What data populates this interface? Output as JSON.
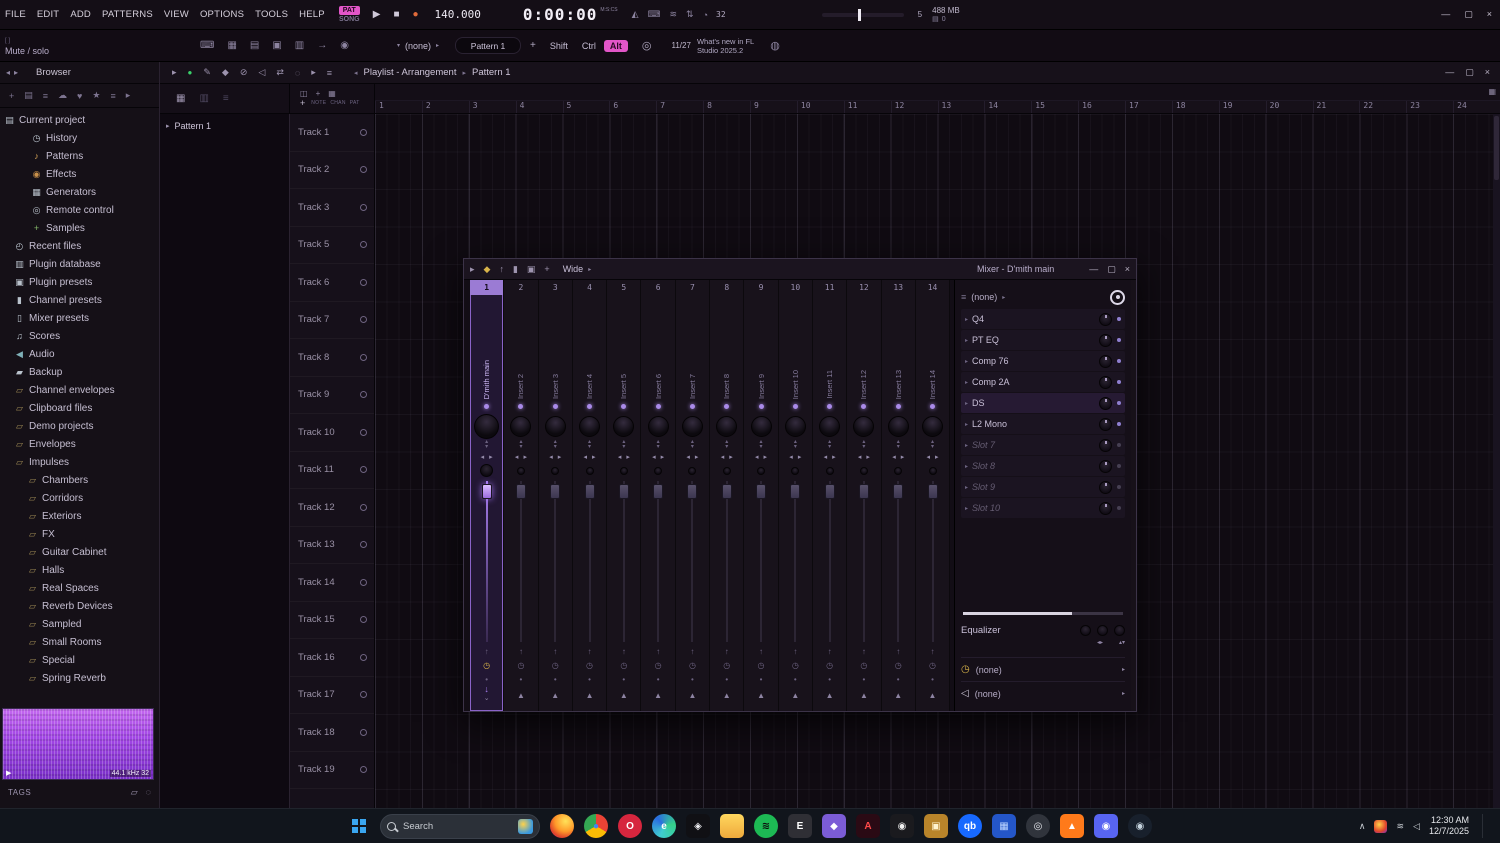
{
  "window": {
    "minimize": "—",
    "maximize": "▢",
    "close": "×"
  },
  "titlebar": {
    "menus": [
      "FILE",
      "EDIT",
      "ADD",
      "PATTERNS",
      "VIEW",
      "OPTIONS",
      "TOOLS",
      "HELP"
    ],
    "pat": "PAT",
    "song": "SONG",
    "play": "▶",
    "stop": "■",
    "record": "●",
    "tempo": "140.000",
    "time": "0:00:00",
    "time_unit": "M:S:CS",
    "count_label": "32",
    "mid_icons": [
      {
        "name": "metronome-icon",
        "glyph": "◭"
      },
      {
        "name": "typing-keyboard-icon",
        "glyph": "⌨"
      },
      {
        "name": "wave-icon",
        "glyph": "≋"
      },
      {
        "name": "multilink-icon",
        "glyph": "⇅"
      },
      {
        "name": "countdown-icon",
        "glyph": "◔"
      }
    ],
    "marker_value": "5",
    "mem": "488 MB",
    "disk_glyph": "▤",
    "disk_value": "0"
  },
  "hintbar": {
    "brackets": "[ ]",
    "hint": "Mute / solo",
    "left_icons": [
      {
        "name": "typing-to-piano-icon",
        "glyph": "⌨"
      },
      {
        "name": "piano-keyboard-icon",
        "glyph": "▦"
      },
      {
        "name": "step-edit-icon",
        "glyph": "▤"
      },
      {
        "name": "note-grid-icon",
        "glyph": "▣"
      },
      {
        "name": "snap-icon",
        "glyph": "▥"
      },
      {
        "name": "arrow-tool-icon",
        "glyph": "→"
      },
      {
        "name": "mic-icon",
        "glyph": "◉"
      }
    ],
    "selector_down": "▾",
    "selector_value": "(none)",
    "selector_right": "▸",
    "pattern_display": "Pattern 1",
    "add_label": "+",
    "shift": "Shift",
    "ctrl": "Ctrl",
    "alt": "Alt",
    "swirl_glyph": "◎",
    "news_date": "11/27",
    "news_line1": "What's new in FL",
    "news_line2": "Studio 2025.2",
    "globe_glyph": "◍"
  },
  "browser": {
    "nav_left": "◂",
    "nav_right": "▸",
    "title": "Browser",
    "tool_icons": [
      {
        "name": "add-icon",
        "glyph": "+"
      },
      {
        "name": "file-icon",
        "glyph": "▤"
      },
      {
        "name": "sort-icon",
        "glyph": "≡"
      },
      {
        "name": "cloud-icon",
        "glyph": "☁"
      },
      {
        "name": "heart-icon",
        "glyph": "♥"
      },
      {
        "name": "star-icon",
        "glyph": "★"
      },
      {
        "name": "list-icon",
        "glyph": "≡"
      },
      {
        "name": "expand-icon",
        "glyph": "▸"
      }
    ],
    "items": [
      {
        "label": "Current project",
        "icon": "project-icon",
        "glyph": "▤",
        "color": "#b9c2cc",
        "cls": "lv0"
      },
      {
        "label": "History",
        "icon": "history-icon",
        "glyph": "◷",
        "color": "#b9c2cc",
        "cls": "lv1"
      },
      {
        "label": "Patterns",
        "icon": "pattern-icon",
        "glyph": "♪",
        "color": "#d9a65a",
        "cls": "lv1"
      },
      {
        "label": "Effects",
        "icon": "effects-icon",
        "glyph": "◉",
        "color": "#c9904a",
        "cls": "lv1"
      },
      {
        "label": "Generators",
        "icon": "generators-icon",
        "glyph": "▦",
        "color": "#b9c2cc",
        "cls": "lv1"
      },
      {
        "label": "Remote control",
        "icon": "remote-control-icon",
        "glyph": "◎",
        "color": "#b9c2cc",
        "cls": "lv1"
      },
      {
        "label": "Samples",
        "icon": "samples-icon",
        "glyph": "+",
        "color": "#85b86a",
        "cls": "lv1"
      },
      {
        "label": "Recent files",
        "icon": "recent-files-icon",
        "glyph": "◴",
        "color": "#b9c2cc",
        "cls": "lv2"
      },
      {
        "label": "Plugin database",
        "icon": "plugin-database-icon",
        "glyph": "▥",
        "color": "#b9c2cc",
        "cls": "lv2"
      },
      {
        "label": "Plugin presets",
        "icon": "plugin-presets-icon",
        "glyph": "▣",
        "color": "#b9c2cc",
        "cls": "lv2"
      },
      {
        "label": "Channel presets",
        "icon": "channel-presets-icon",
        "glyph": "▮",
        "color": "#b9c2cc",
        "cls": "lv2"
      },
      {
        "label": "Mixer presets",
        "icon": "mixer-presets-icon",
        "glyph": "▯",
        "color": "#b9c2cc",
        "cls": "lv2"
      },
      {
        "label": "Scores",
        "icon": "scores-icon",
        "glyph": "♫",
        "color": "#b9c2cc",
        "cls": "lv2"
      },
      {
        "label": "Audio",
        "icon": "audio-icon",
        "glyph": "◀",
        "color": "#7fb0b8",
        "cls": "lv2"
      },
      {
        "label": "Backup",
        "icon": "backup-icon",
        "glyph": "▰",
        "color": "#b9c2cc",
        "cls": "lv2"
      },
      {
        "label": "Channel envelopes",
        "icon": "folder-icon",
        "glyph": "▱",
        "color": "#a08b55",
        "cls": "lv2"
      },
      {
        "label": "Clipboard files",
        "icon": "folder-icon",
        "glyph": "▱",
        "color": "#a08b55",
        "cls": "lv2"
      },
      {
        "label": "Demo projects",
        "icon": "folder-icon",
        "glyph": "▱",
        "color": "#a08b55",
        "cls": "lv2"
      },
      {
        "label": "Envelopes",
        "icon": "folder-icon",
        "glyph": "▱",
        "color": "#a08b55",
        "cls": "lv2"
      },
      {
        "label": "Impulses",
        "icon": "folder-icon",
        "glyph": "▱",
        "color": "#a08b55",
        "cls": "lv2"
      },
      {
        "label": "Chambers",
        "icon": "folder-icon",
        "glyph": "▱",
        "color": "#a08b55",
        "cls": "lv3"
      },
      {
        "label": "Corridors",
        "icon": "folder-icon",
        "glyph": "▱",
        "color": "#a08b55",
        "cls": "lv3"
      },
      {
        "label": "Exteriors",
        "icon": "folder-icon",
        "glyph": "▱",
        "color": "#a08b55",
        "cls": "lv3"
      },
      {
        "label": "FX",
        "icon": "folder-icon",
        "glyph": "▱",
        "color": "#a08b55",
        "cls": "lv3"
      },
      {
        "label": "Guitar Cabinet",
        "icon": "folder-icon",
        "glyph": "▱",
        "color": "#a08b55",
        "cls": "lv3"
      },
      {
        "label": "Halls",
        "icon": "folder-icon",
        "glyph": "▱",
        "color": "#a08b55",
        "cls": "lv3"
      },
      {
        "label": "Real Spaces",
        "icon": "folder-icon",
        "glyph": "▱",
        "color": "#a08b55",
        "cls": "lv3"
      },
      {
        "label": "Reverb Devices",
        "icon": "folder-icon",
        "glyph": "▱",
        "color": "#a08b55",
        "cls": "lv3"
      },
      {
        "label": "Sampled",
        "icon": "folder-icon",
        "glyph": "▱",
        "color": "#a08b55",
        "cls": "lv3"
      },
      {
        "label": "Small Rooms",
        "icon": "folder-icon",
        "glyph": "▱",
        "color": "#a08b55",
        "cls": "lv3"
      },
      {
        "label": "Special",
        "icon": "folder-icon",
        "glyph": "▱",
        "color": "#a08b55",
        "cls": "lv3"
      },
      {
        "label": "Spring Reverb",
        "icon": "folder-icon",
        "glyph": "▱",
        "color": "#a08b55",
        "cls": "lv3"
      }
    ],
    "wave_play": "▶",
    "sample_info": "44.1 kHz 32",
    "tags_label": "TAGS",
    "tags_icons": [
      {
        "name": "folder-icon",
        "glyph": "▱"
      },
      {
        "name": "search-icon",
        "glyph": "◌"
      }
    ]
  },
  "playlist": {
    "header_icons": [
      {
        "name": "playlist-menu-icon",
        "glyph": "▸"
      },
      {
        "name": "record-status-icon",
        "glyph": "●",
        "cls": "grn"
      },
      {
        "name": "draw-tool-icon",
        "glyph": "✎"
      },
      {
        "name": "paint-tool-icon",
        "glyph": "◆"
      },
      {
        "name": "delete-tool-icon",
        "glyph": "⊘"
      },
      {
        "name": "mute-tool-icon",
        "glyph": "◁"
      },
      {
        "name": "slip-tool-icon",
        "glyph": "⇄"
      },
      {
        "name": "zoom-tool-icon",
        "glyph": "◌"
      },
      {
        "name": "playback-tool-icon",
        "glyph": "▸"
      },
      {
        "name": "options-icon",
        "glyph": "≡"
      }
    ],
    "nav_back": "◂",
    "title": "Playlist - Arrangement",
    "crumb_sep": "▸",
    "crumb": "Pattern 1",
    "seg1_icons": [
      {
        "name": "pattern-view-icon",
        "glyph": "▦"
      },
      {
        "name": "audio-view-icon",
        "glyph": "▥",
        "cls": "dim"
      },
      {
        "name": "auto-view-icon",
        "glyph": "≡",
        "cls": "dim"
      }
    ],
    "seg2_icons": [
      {
        "name": "note-icon",
        "glyph": "◫"
      },
      {
        "name": "add-track-icon",
        "glyph": "+"
      },
      {
        "name": "grid-icon",
        "glyph": "▦"
      }
    ],
    "add_label": "+",
    "picker_tabs": [
      "NOTE",
      "CHAN",
      "PAT"
    ],
    "grid_options_glyph": "▦",
    "picker_items": [
      {
        "arrow": "▸",
        "label": "Pattern 1"
      }
    ],
    "timeline": [
      "1",
      "2",
      "3",
      "4",
      "5",
      "6",
      "7",
      "8",
      "9",
      "10",
      "11",
      "12",
      "13",
      "14",
      "15",
      "16",
      "17",
      "18",
      "19",
      "20",
      "21",
      "22",
      "23",
      "24"
    ],
    "tracks": [
      "Track 1",
      "Track 2",
      "Track 3",
      "Track 5",
      "Track 6",
      "Track 7",
      "Track 8",
      "Track 9",
      "Track 10",
      "Track 11",
      "Track 12",
      "Track 13",
      "Track 14",
      "Track 15",
      "Track 16",
      "Track 17",
      "Track 18",
      "Track 19"
    ]
  },
  "mixer": {
    "title": "Mixer - D'mith main",
    "toolbar_icons": [
      {
        "name": "mixer-menu-icon",
        "glyph": "▸"
      },
      {
        "name": "paint-bucket-icon",
        "glyph": "◆",
        "color": "#d8b44a"
      },
      {
        "name": "upload-icon",
        "glyph": "↑"
      },
      {
        "name": "select-strip-icon",
        "glyph": "▮"
      },
      {
        "name": "detach-window-icon",
        "glyph": "▣"
      },
      {
        "name": "add-insert-icon",
        "glyph": "+"
      }
    ],
    "view_mode": "Wide",
    "view_chevron": "▸",
    "strip_icons": {
      "ud_up": "▴",
      "ud_down": "▾",
      "left": "◂",
      "right": "▸",
      "up": "↑",
      "clock": "◷",
      "dot": "•",
      "route": "▲",
      "route_sel": "↓",
      "caret": "⌄"
    },
    "channels": [
      {
        "num": "1",
        "name": "D'mith main",
        "cls": "selected"
      },
      {
        "num": "2",
        "name": "Insert 2"
      },
      {
        "num": "3",
        "name": "Insert 3"
      },
      {
        "num": "4",
        "name": "Insert 4"
      },
      {
        "num": "5",
        "name": "Insert 5"
      },
      {
        "num": "6",
        "name": "Insert 6"
      },
      {
        "num": "7",
        "name": "Insert 7"
      },
      {
        "num": "8",
        "name": "Insert 8"
      },
      {
        "num": "9",
        "name": "Insert 9"
      },
      {
        "num": "10",
        "name": "Insert 10"
      },
      {
        "num": "11",
        "name": "Insert 11"
      },
      {
        "num": "12",
        "name": "Insert 12"
      },
      {
        "num": "13",
        "name": "Insert 13"
      },
      {
        "num": "14",
        "name": "Insert 14"
      }
    ],
    "top_slot_icon": "≡",
    "top_slot_value": "(none)",
    "top_slot_chevron": "▸",
    "slot_arrow": "▸",
    "slots": [
      {
        "name": "Q4"
      },
      {
        "name": "PT EQ"
      },
      {
        "name": "Comp 76"
      },
      {
        "name": "Comp 2A"
      },
      {
        "name": "DS",
        "cls": "active"
      },
      {
        "name": "L2 Mono"
      },
      {
        "name": "Slot 7",
        "cls": "dim"
      },
      {
        "name": "Slot 8",
        "cls": "dim"
      },
      {
        "name": "Slot 9",
        "cls": "dim"
      },
      {
        "name": "Slot 10",
        "cls": "dim"
      }
    ],
    "equalizer_label": "Equalizer",
    "eq_arrows_h": "◂▸",
    "eq_arrows_v": "▴▾",
    "sends": [
      {
        "icon_glyph": "◷",
        "icon_name": "delay-send-icon",
        "icon_cls": "clk",
        "value": "(none)",
        "chevron": "▸"
      },
      {
        "icon_glyph": "◁",
        "icon_name": "audio-output-icon",
        "icon_cls": "spk",
        "value": "(none)",
        "chevron": "▸"
      }
    ]
  },
  "taskbar": {
    "search_label": "Search",
    "icons": [
      {
        "name": "firefox-icon",
        "glyph": "",
        "bg": "radial-gradient(circle at 65% 30%, #ffe259, #ff9a2a 45%, #e0452a 72%, #c026a8)",
        "fg": "#fff",
        "cls": "circle"
      },
      {
        "name": "chrome-icon",
        "glyph": "●",
        "bg": "conic-gradient(#ea4335 0deg 120deg, #fbbc05 120deg 240deg, #34a853 240deg 360deg)",
        "fg": "#4285f4",
        "cls": "circle"
      },
      {
        "name": "opera-icon",
        "glyph": "O",
        "bg": "#d6263e",
        "fg": "#ffffff",
        "cls": "circle"
      },
      {
        "name": "edge-icon",
        "glyph": "e",
        "bg": "conic-gradient(from 200deg, #40ccd0, #2a6de0, #35d08a, #40ccd0)",
        "fg": "#ffffff",
        "cls": "circle"
      },
      {
        "name": "apple-icon",
        "glyph": "◈",
        "bg": "#101014",
        "fg": "#f0f0f4"
      },
      {
        "name": "file-explorer-icon",
        "glyph": "",
        "bg": "linear-gradient(180deg,#ffd75e,#efa93c)",
        "fg": "#8a5a10"
      },
      {
        "name": "spotify-icon",
        "glyph": "≋",
        "bg": "#1db954",
        "fg": "#0c0c0c",
        "cls": "circle"
      },
      {
        "name": "epic-games-icon",
        "glyph": "E",
        "bg": "#2f2f35",
        "fg": "#ffffff"
      },
      {
        "name": "purple-app-icon",
        "glyph": "◆",
        "bg": "#7b5cd6",
        "fg": "#ffffff"
      },
      {
        "name": "adobe-app-icon",
        "glyph": "A",
        "bg": "#2a0a14",
        "fg": "#ff4a4a"
      },
      {
        "name": "camera-app-icon",
        "glyph": "◉",
        "bg": "#1a1a1e",
        "fg": "#f0f0f0"
      },
      {
        "name": "amber-app-icon",
        "glyph": "▣",
        "bg": "#b8842a",
        "fg": "#fff3d0"
      },
      {
        "name": "qb-app-icon",
        "glyph": "qb",
        "bg": "#1769ff",
        "fg": "#ffffff",
        "cls": "circle"
      },
      {
        "name": "blue-app-icon",
        "glyph": "▦",
        "bg": "#2456c8",
        "fg": "#bcd4ff"
      },
      {
        "name": "obs-app-icon",
        "glyph": "◎",
        "bg": "#30343c",
        "fg": "#e8eaf0",
        "cls": "circle"
      },
      {
        "name": "vlc-app-icon",
        "glyph": "▲",
        "bg": "#ff7a1a",
        "fg": "#ffffff"
      },
      {
        "name": "discord-icon",
        "glyph": "◉",
        "bg": "#5865f2",
        "fg": "#ffffff"
      },
      {
        "name": "steam-icon",
        "glyph": "◉",
        "bg": "#18202c",
        "fg": "#c7d5e0",
        "cls": "circle"
      }
    ],
    "tray_chevron": "∧",
    "tray_icons": [
      {
        "name": "network-icon",
        "glyph": "≋"
      },
      {
        "name": "volume-icon",
        "glyph": "◁"
      }
    ],
    "time": "12:30 AM",
    "date": "12/7/2025"
  }
}
